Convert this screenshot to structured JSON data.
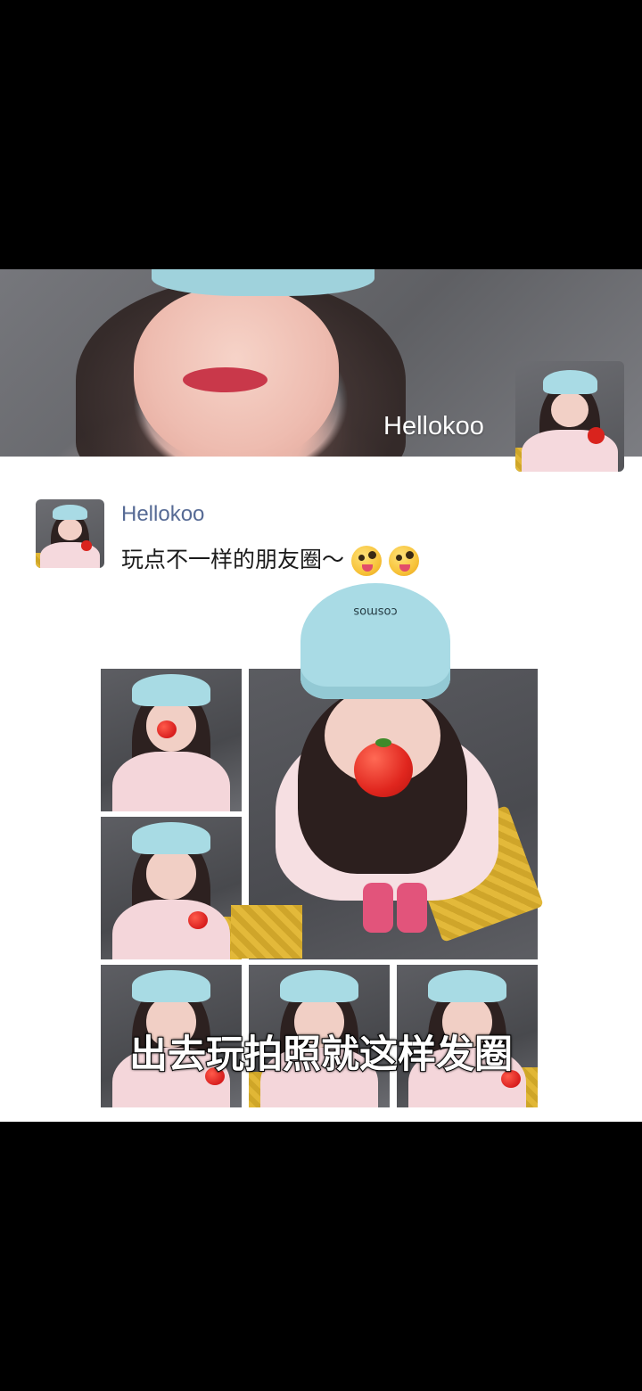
{
  "cover": {
    "owner_name": "Hellokoo"
  },
  "post": {
    "author": "Hellokoo",
    "text": "玩点不一样的朋友圈～",
    "emojis": [
      "zany-face-emoji",
      "zany-face-emoji"
    ],
    "photo_count": 9
  },
  "big_photo": {
    "cap_text": "cosmos"
  },
  "caption": {
    "text": "出去玩拍照就这样发圈"
  },
  "colors": {
    "name_link": "#576b95",
    "panel_bg": "#ffffff",
    "page_bg": "#000000"
  }
}
